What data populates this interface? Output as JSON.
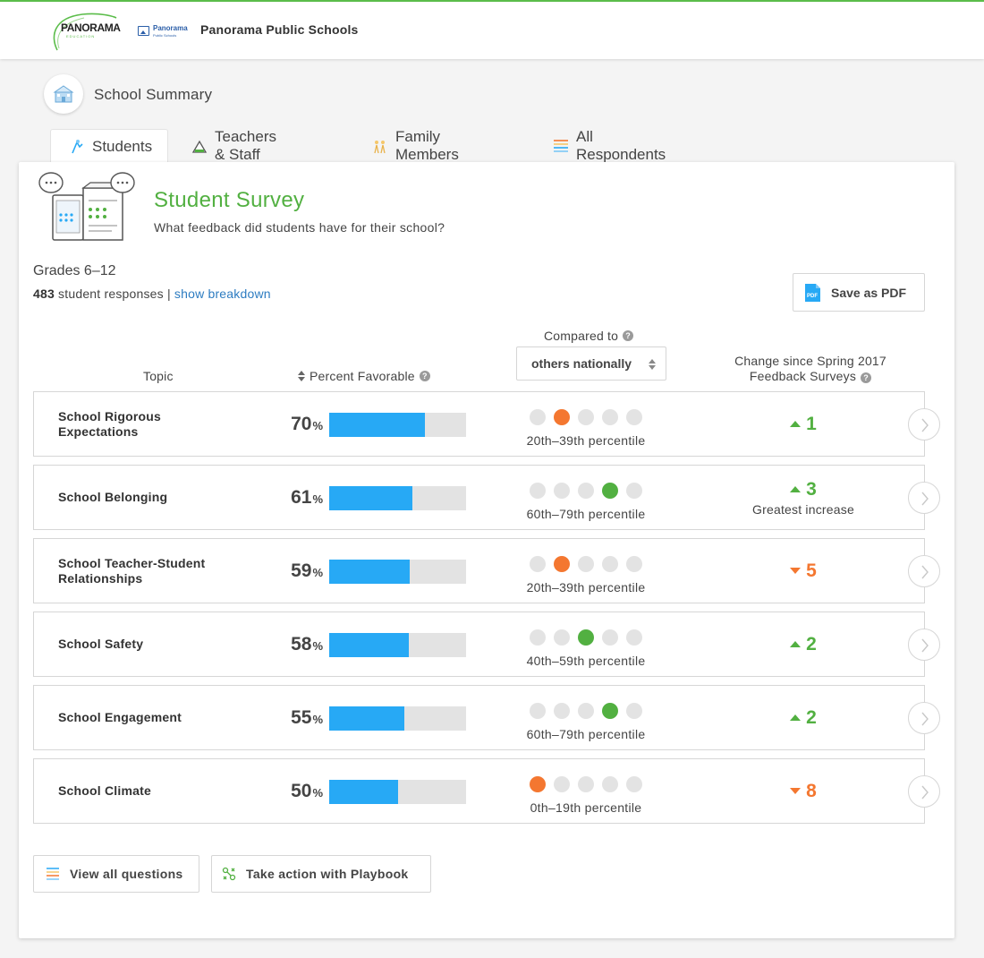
{
  "header": {
    "logo_text": "PANORAMA",
    "logo_subtext": "EDUCATION",
    "district_logo_line1": "Panorama",
    "district_logo_line2": "Public Schools",
    "district_name": "Panorama Public Schools"
  },
  "page": {
    "title": "School Summary"
  },
  "tabs": [
    {
      "label": "Students",
      "icon": "student-icon",
      "active": true
    },
    {
      "label": "Teachers & Staff",
      "icon": "teacher-icon",
      "active": false
    },
    {
      "label": "Family Members",
      "icon": "family-icon",
      "active": false
    },
    {
      "label": "All Respondents",
      "icon": "respondents-icon",
      "active": false
    }
  ],
  "survey": {
    "title": "Student Survey",
    "subtitle": "What feedback did students have for their school?",
    "grades": "Grades 6–12",
    "response_count": "483",
    "response_text": " student responses | ",
    "breakdown_link": "show breakdown",
    "save_pdf": "Save as PDF"
  },
  "table": {
    "col_topic": "Topic",
    "col_percent": "Percent Favorable",
    "compared_to": "Compared to",
    "compare_selected": "others nationally",
    "col_change_line1": "Change since Spring 2017",
    "col_change_line2": "Feedback Surveys",
    "help_icon": "?",
    "pct_unit": "%",
    "rows": [
      {
        "topic": "School Rigorous Expectations",
        "percent": "70",
        "fill": 0.7,
        "quintile": 1,
        "percentile": "20th–39th percentile",
        "change": "1",
        "direction": "up",
        "note": ""
      },
      {
        "topic": "School Belonging",
        "percent": "61",
        "fill": 0.61,
        "quintile": 3,
        "percentile": "60th–79th percentile",
        "change": "3",
        "direction": "up",
        "note": "Greatest increase"
      },
      {
        "topic": "School Teacher-Student Relationships",
        "percent": "59",
        "fill": 0.59,
        "quintile": 1,
        "percentile": "20th–39th percentile",
        "change": "5",
        "direction": "down",
        "note": ""
      },
      {
        "topic": "School Safety",
        "percent": "58",
        "fill": 0.58,
        "quintile": 2,
        "percentile": "40th–59th percentile",
        "change": "2",
        "direction": "up",
        "note": ""
      },
      {
        "topic": "School Engagement",
        "percent": "55",
        "fill": 0.55,
        "quintile": 3,
        "percentile": "60th–79th percentile",
        "change": "2",
        "direction": "up",
        "note": ""
      },
      {
        "topic": "School Climate",
        "percent": "50",
        "fill": 0.5,
        "quintile": 0,
        "percentile": "0th–19th percentile",
        "change": "8",
        "direction": "down",
        "note": ""
      }
    ]
  },
  "actions": {
    "view_questions": "View all questions",
    "playbook": "Take action with Playbook"
  },
  "colors": {
    "brand_green": "#52b041",
    "bar_blue": "#27a9f5",
    "low_orange": "#f47730",
    "dot_gray": "#e3e3e3",
    "link_blue": "#2d7cc1"
  }
}
